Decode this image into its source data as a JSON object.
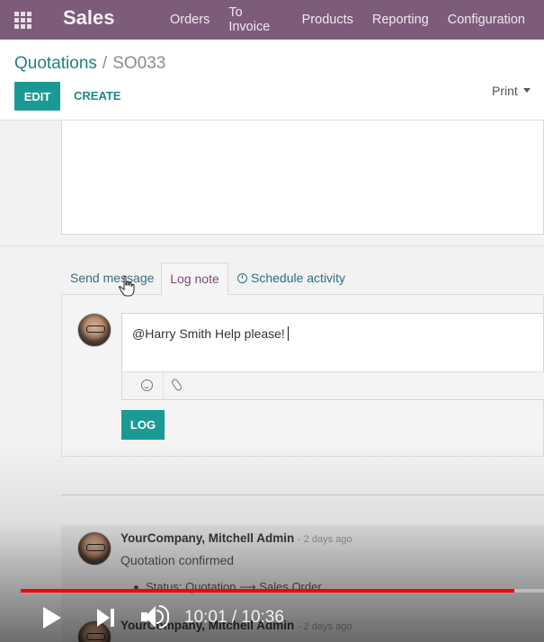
{
  "navbar": {
    "app_name": "Sales",
    "menu": [
      "Orders",
      "To Invoice",
      "Products",
      "Reporting",
      "Configuration"
    ]
  },
  "control": {
    "breadcrumb_parent": "Quotations",
    "breadcrumb_separator": "/",
    "breadcrumb_current": "SO033",
    "edit_label": "EDIT",
    "create_label": "CREATE",
    "print_label": "Print"
  },
  "chatter": {
    "tabs": {
      "send_message": "Send message",
      "log_note": "Log note",
      "schedule_activity": "Schedule activity"
    },
    "composer_text": "@Harry Smith Help please!",
    "log_button": "LOG",
    "messages": [
      {
        "author": "YourCompany, Mitchell Admin",
        "date": "- 2 days ago",
        "body": "Quotation confirmed",
        "tracking": "Status: Quotation ⟶ Sales Order"
      },
      {
        "author": "YourCompany, Mitchell Admin",
        "date": "- 2 days ago"
      }
    ]
  },
  "video_player": {
    "current_time": "10:01",
    "separator": "/",
    "duration": "10:36",
    "progress": 0.944,
    "progress_color": "#ff0000"
  },
  "colors": {
    "navbar": "#7c5c79",
    "primary_button": "#1b9a95",
    "link": "#21827e"
  },
  "icons": [
    "apps-grid-icon",
    "caret-down-icon",
    "clock-icon",
    "emoji-icon",
    "paperclip-icon",
    "play-icon",
    "next-icon",
    "volume-icon",
    "mouse-pointer-icon"
  ]
}
